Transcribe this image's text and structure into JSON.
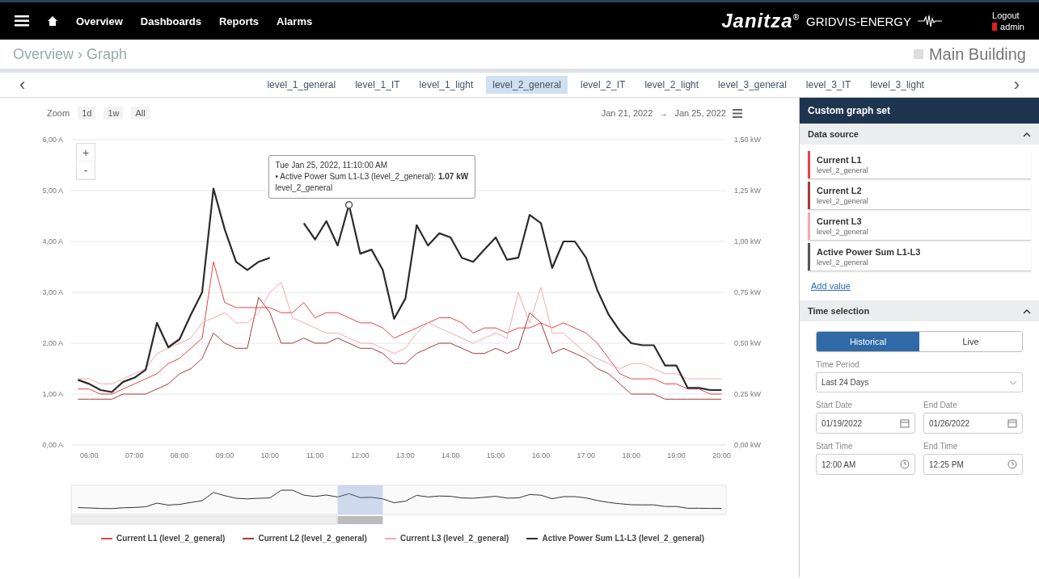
{
  "header": {
    "nav": [
      {
        "label": "Overview"
      },
      {
        "label": "Dashboards"
      },
      {
        "label": "Reports"
      },
      {
        "label": "Alarms"
      }
    ],
    "brand": "Janitza",
    "brand_mark": "®",
    "product": "GRIDVIS-ENERGY",
    "logout": "Logout",
    "user": "admin"
  },
  "breadcrumb": {
    "path": "Overview › Graph",
    "location": "Main Building"
  },
  "tabs": [
    {
      "label": "level_1_general",
      "selected": false
    },
    {
      "label": "level_1_IT",
      "selected": false
    },
    {
      "label": "level_1_light",
      "selected": false
    },
    {
      "label": "level_2_general",
      "selected": true
    },
    {
      "label": "level_2_IT",
      "selected": false
    },
    {
      "label": "level_2_light",
      "selected": false
    },
    {
      "label": "level_3_general",
      "selected": false
    },
    {
      "label": "level_3_IT",
      "selected": false
    },
    {
      "label": "level_3_light",
      "selected": false
    }
  ],
  "tab_prev": "‹",
  "tab_next": "›",
  "chart": {
    "zoom_label": "Zoom",
    "zoom_options": [
      {
        "label": "1d"
      },
      {
        "label": "1w"
      },
      {
        "label": "All"
      }
    ],
    "zoom_in": "+",
    "zoom_out": "-",
    "range_from": "Jan 21, 2022",
    "range_arrow": "→",
    "range_to": "Jan 25, 2022",
    "tooltip": {
      "title": "Tue Jan 25, 2022, 11:10:00 AM",
      "line": "• Active Power Sum L1-L3 (level_2_general): **1.07 kW**",
      "sub": "level_2_general"
    },
    "chart_data": {
      "type": "line",
      "grid": true,
      "x": [
        5.75,
        6,
        6.25,
        6.5,
        6.75,
        7,
        7.25,
        7.5,
        7.75,
        8,
        8.25,
        8.5,
        8.75,
        9,
        9.25,
        9.5,
        9.75,
        10,
        10.25,
        10.5,
        10.75,
        11,
        11.25,
        11.5,
        11.75,
        12,
        12.25,
        12.5,
        12.75,
        13,
        13.25,
        13.5,
        13.75,
        14,
        14.25,
        14.5,
        14.75,
        15,
        15.25,
        15.5,
        15.75,
        16,
        16.25,
        16.5,
        16.75,
        17,
        17.25,
        17.5,
        17.75,
        18,
        18.25,
        18.5,
        18.75,
        19,
        19.25,
        19.5,
        19.75,
        20
      ],
      "xlim": [
        5.6,
        20.1
      ],
      "ylim": [
        0,
        6
      ],
      "y2lim": [
        0,
        1.5
      ],
      "xticks": [
        {
          "value": 6,
          "label": "06:00"
        },
        {
          "value": 7,
          "label": "07:00"
        },
        {
          "value": 8,
          "label": "08:00"
        },
        {
          "value": 9,
          "label": "09:00"
        },
        {
          "value": 10,
          "label": "10:00"
        },
        {
          "value": 11,
          "label": "11:00"
        },
        {
          "value": 12,
          "label": "12:00"
        },
        {
          "value": 13,
          "label": "13:00"
        },
        {
          "value": 14,
          "label": "14:00"
        },
        {
          "value": 15,
          "label": "15:00"
        },
        {
          "value": 16,
          "label": "16:00"
        },
        {
          "value": 17,
          "label": "17:00"
        },
        {
          "value": 18,
          "label": "18:00"
        },
        {
          "value": 19,
          "label": "19:00"
        },
        {
          "value": 20,
          "label": "20:00"
        }
      ],
      "yticks": [
        {
          "value": 0,
          "label": "0,00 A"
        },
        {
          "value": 1,
          "label": "1,00 A"
        },
        {
          "value": 2,
          "label": "2,00 A"
        },
        {
          "value": 3,
          "label": "3,00 A"
        },
        {
          "value": 4,
          "label": "4,00 A"
        },
        {
          "value": 5,
          "label": "5,00 A"
        },
        {
          "value": 6,
          "label": "6,00 A"
        }
      ],
      "y2ticks": [
        {
          "value": 0,
          "label": "0,00 kW"
        },
        {
          "value": 0.25,
          "label": "0,25 kW"
        },
        {
          "value": 0.5,
          "label": "0,50 kW"
        },
        {
          "value": 0.75,
          "label": "0,75 kW"
        },
        {
          "value": 1,
          "label": "1,00 kW"
        },
        {
          "value": 1.25,
          "label": "1,25 kW"
        },
        {
          "value": 1.5,
          "label": "1,50 kW"
        }
      ],
      "series": [
        {
          "name": "Current L1 (level_2_general)",
          "color": "#e8434a",
          "values": [
            1.1,
            1.1,
            1.0,
            1.0,
            1.1,
            1.2,
            1.3,
            1.4,
            1.6,
            1.7,
            1.9,
            2.1,
            3.6,
            2.8,
            2.7,
            2.7,
            2.7,
            2.7,
            2.6,
            2.6,
            2.8,
            2.5,
            2.6,
            2.6,
            2.5,
            2.4,
            2.4,
            2.3,
            2.1,
            2.2,
            2.3,
            2.4,
            2.5,
            2.5,
            2.4,
            2.2,
            2.3,
            2.3,
            2.2,
            2.3,
            2.3,
            2.4,
            2.3,
            2.4,
            2.3,
            2.2,
            2.0,
            1.7,
            1.4,
            1.3,
            1.3,
            1.3,
            1.2,
            1.2,
            1.1,
            1.1,
            1.0,
            1.0
          ]
        },
        {
          "name": "Current L2 (level_2_general)",
          "color": "#a83a3a",
          "values": [
            0.9,
            0.9,
            0.9,
            0.9,
            1.0,
            1.0,
            1.0,
            1.1,
            1.2,
            1.4,
            1.5,
            1.7,
            2.2,
            2.0,
            1.9,
            1.9,
            2.9,
            2.6,
            2.0,
            2.0,
            2.1,
            2.0,
            2.0,
            2.1,
            2.0,
            1.9,
            1.9,
            1.8,
            1.6,
            1.6,
            1.8,
            1.9,
            2.0,
            2.0,
            1.9,
            1.8,
            1.8,
            1.9,
            1.8,
            1.9,
            2.6,
            2.4,
            1.8,
            1.9,
            1.8,
            1.7,
            1.5,
            1.4,
            1.2,
            1.0,
            1.0,
            1.0,
            0.9,
            0.9,
            0.9,
            0.9,
            0.9,
            0.9
          ]
        },
        {
          "name": "Current L3 (level_2_general)",
          "color": "#f4a9ae",
          "values": [
            1.3,
            1.3,
            1.2,
            1.2,
            1.3,
            1.4,
            1.5,
            1.8,
            1.9,
            2.0,
            2.1,
            2.4,
            2.5,
            2.6,
            2.4,
            2.4,
            2.6,
            3.0,
            3.2,
            2.5,
            2.4,
            2.3,
            2.2,
            2.2,
            2.1,
            2.0,
            2.0,
            1.9,
            1.8,
            1.9,
            2.2,
            2.4,
            2.3,
            2.2,
            2.1,
            2.0,
            2.1,
            2.2,
            2.1,
            3.0,
            2.4,
            3.1,
            2.2,
            2.2,
            2.0,
            1.8,
            1.7,
            1.6,
            1.5,
            1.6,
            1.6,
            1.5,
            1.4,
            1.4,
            1.3,
            1.3,
            1.3,
            1.3
          ]
        },
        {
          "name": "Active Power Sum L1-L3 (level_2_general)",
          "color": "#2b2b2b",
          "axis": "y2",
          "values": [
            0.32,
            0.3,
            0.27,
            0.26,
            0.31,
            0.33,
            0.37,
            0.6,
            0.48,
            0.52,
            0.64,
            0.75,
            1.26,
            1.06,
            0.9,
            0.86,
            0.9,
            0.92,
            null,
            null,
            1.09,
            1.01,
            1.1,
            0.98,
            1.18,
            0.94,
            0.96,
            0.86,
            0.62,
            0.72,
            1.08,
            0.98,
            1.04,
            1.02,
            0.92,
            0.9,
            0.96,
            1.02,
            0.91,
            0.92,
            1.13,
            1.09,
            0.87,
            1.0,
            1.0,
            0.92,
            0.76,
            0.64,
            0.56,
            0.5,
            0.49,
            0.49,
            0.39,
            0.39,
            0.28,
            0.28,
            0.27,
            0.27
          ]
        }
      ]
    }
  },
  "sidebar": {
    "title": "Custom graph set",
    "data_source": {
      "title": "Data source",
      "expanded": true,
      "items": [
        {
          "name": "Current L1",
          "source": "level_2_general",
          "color": "#e8434a"
        },
        {
          "name": "Current L2",
          "source": "level_2_general",
          "color": "#a83a3a"
        },
        {
          "name": "Current L3",
          "source": "level_2_general",
          "color": "#f4a9ae"
        },
        {
          "name": "Active Power Sum L1-L3",
          "source": "level_2_general",
          "color": "#555555"
        }
      ],
      "add_link": "Add value"
    },
    "time_selection": {
      "title": "Time selection",
      "expanded": true,
      "modes": [
        {
          "label": "Historical",
          "selected": true
        },
        {
          "label": "Live",
          "selected": false
        }
      ],
      "fields": [
        {
          "kind": "select",
          "label": "Time Period",
          "value": "Last 24 Days"
        },
        {
          "kind": "date",
          "label": "Start Date",
          "value": "01/19/2022"
        },
        {
          "kind": "date",
          "label": "End Date",
          "value": "01/26/2022"
        },
        {
          "kind": "time",
          "label": "Start Time",
          "value": "12:00 AM"
        },
        {
          "kind": "time",
          "label": "End Time",
          "value": "12:25 PM"
        }
      ]
    }
  }
}
